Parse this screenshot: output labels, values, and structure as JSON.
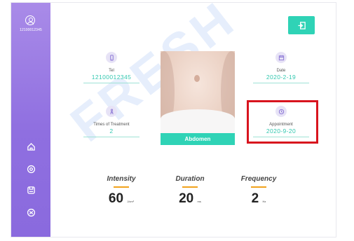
{
  "sidebar": {
    "user_id": "12100012345",
    "icons": [
      "home-icon",
      "settings-icon",
      "save-icon",
      "network-icon"
    ]
  },
  "watermark": "FRESH",
  "header": {
    "exit_icon": "exit-icon",
    "accent_color": "#2fd3b6"
  },
  "info": {
    "tel": {
      "label": "Tel",
      "value": "12100012345",
      "icon": "phone-icon"
    },
    "date": {
      "label": "Date",
      "value": "2020-2-19",
      "icon": "calendar-icon"
    },
    "times": {
      "label": "Times of Treatment",
      "value": "2",
      "icon": "person-icon"
    },
    "appointment": {
      "label": "Appointment",
      "value": "2020-9-20",
      "icon": "clock-icon"
    }
  },
  "photo": {
    "caption": "Abdomen"
  },
  "metrics": {
    "intensity": {
      "title": "Intensity",
      "value": "60",
      "unit": "J/cm²"
    },
    "duration": {
      "title": "Duration",
      "value": "20",
      "unit": "ms"
    },
    "frequency": {
      "title": "Frequency",
      "value": "2",
      "unit": "Hz"
    }
  }
}
